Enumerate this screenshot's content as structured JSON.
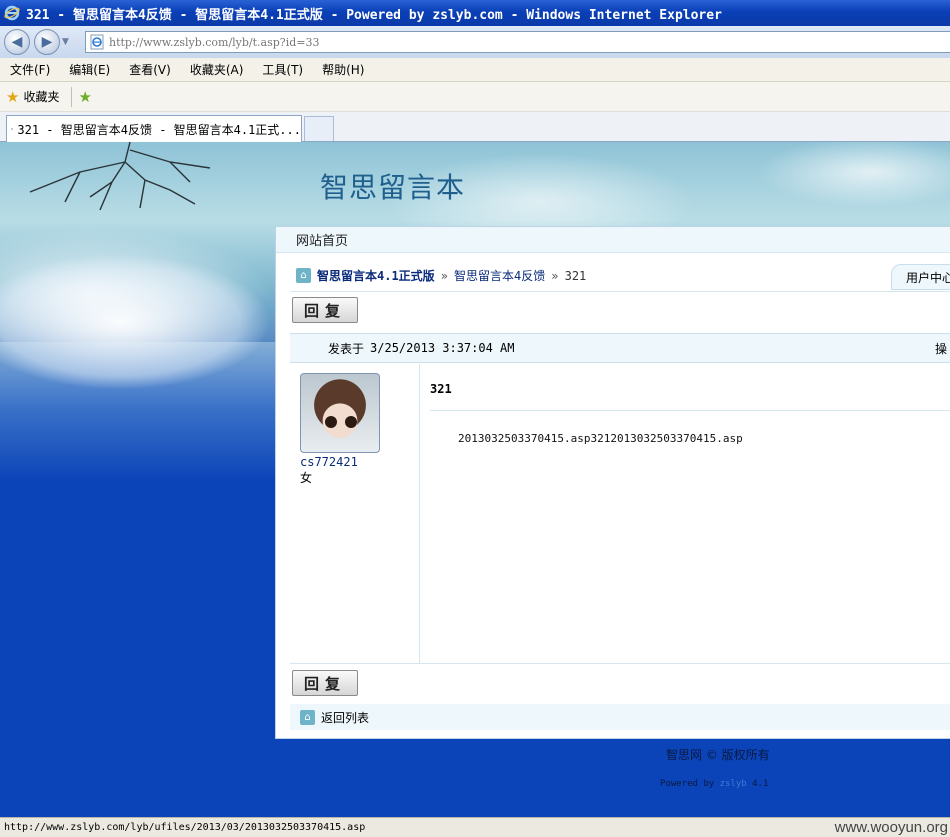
{
  "window": {
    "title": "321 - 智思留言本4反馈 - 智思留言本4.1正式版 - Powered by zslyb.com - Windows Internet Explorer"
  },
  "address_bar": {
    "url": "http://www.zslyb.com/lyb/t.asp?id=33"
  },
  "menu": {
    "items": [
      {
        "label": "文件(F)"
      },
      {
        "label": "编辑(E)"
      },
      {
        "label": "查看(V)"
      },
      {
        "label": "收藏夹(A)"
      },
      {
        "label": "工具(T)"
      },
      {
        "label": "帮助(H)"
      }
    ]
  },
  "favorites_bar": {
    "label": "收藏夹"
  },
  "tab": {
    "title": "321 - 智思留言本4反馈 - 智思留言本4.1正式..."
  },
  "page": {
    "site_title": "智思留言本",
    "top_nav_home": "网站首页",
    "breadcrumb": {
      "root": "智思留言本4.1正式版",
      "section": "智思留言本4反馈",
      "current": "321",
      "separator": "»"
    },
    "user_center": "用户中心",
    "reply_button": "回复",
    "post": {
      "posted_label": "发表于",
      "posted_at": "3/25/2013 3:37:04 AM",
      "actions_label": "操",
      "author": "cs772421",
      "gender": "女",
      "title": "321",
      "body": "2013032503370415.asp3212013032503370415.asp"
    },
    "back_to_list": "返回列表",
    "footer": {
      "copyright": "智思网 © 版权所有",
      "powered_prefix": "Powered by ",
      "powered_brand": "zslyb",
      "powered_version": " 4.1"
    }
  },
  "status_bar": {
    "text": "http://www.zslyb.com/lyb/ufiles/2013/03/2013032503370415.asp",
    "watermark": "www.wooyun.org"
  },
  "colors": {
    "titlebar": "#0a3fb7",
    "page_background": "#0b43b8",
    "link_blue": "#0a2a7a",
    "panel_tint": "#eef7fb"
  }
}
